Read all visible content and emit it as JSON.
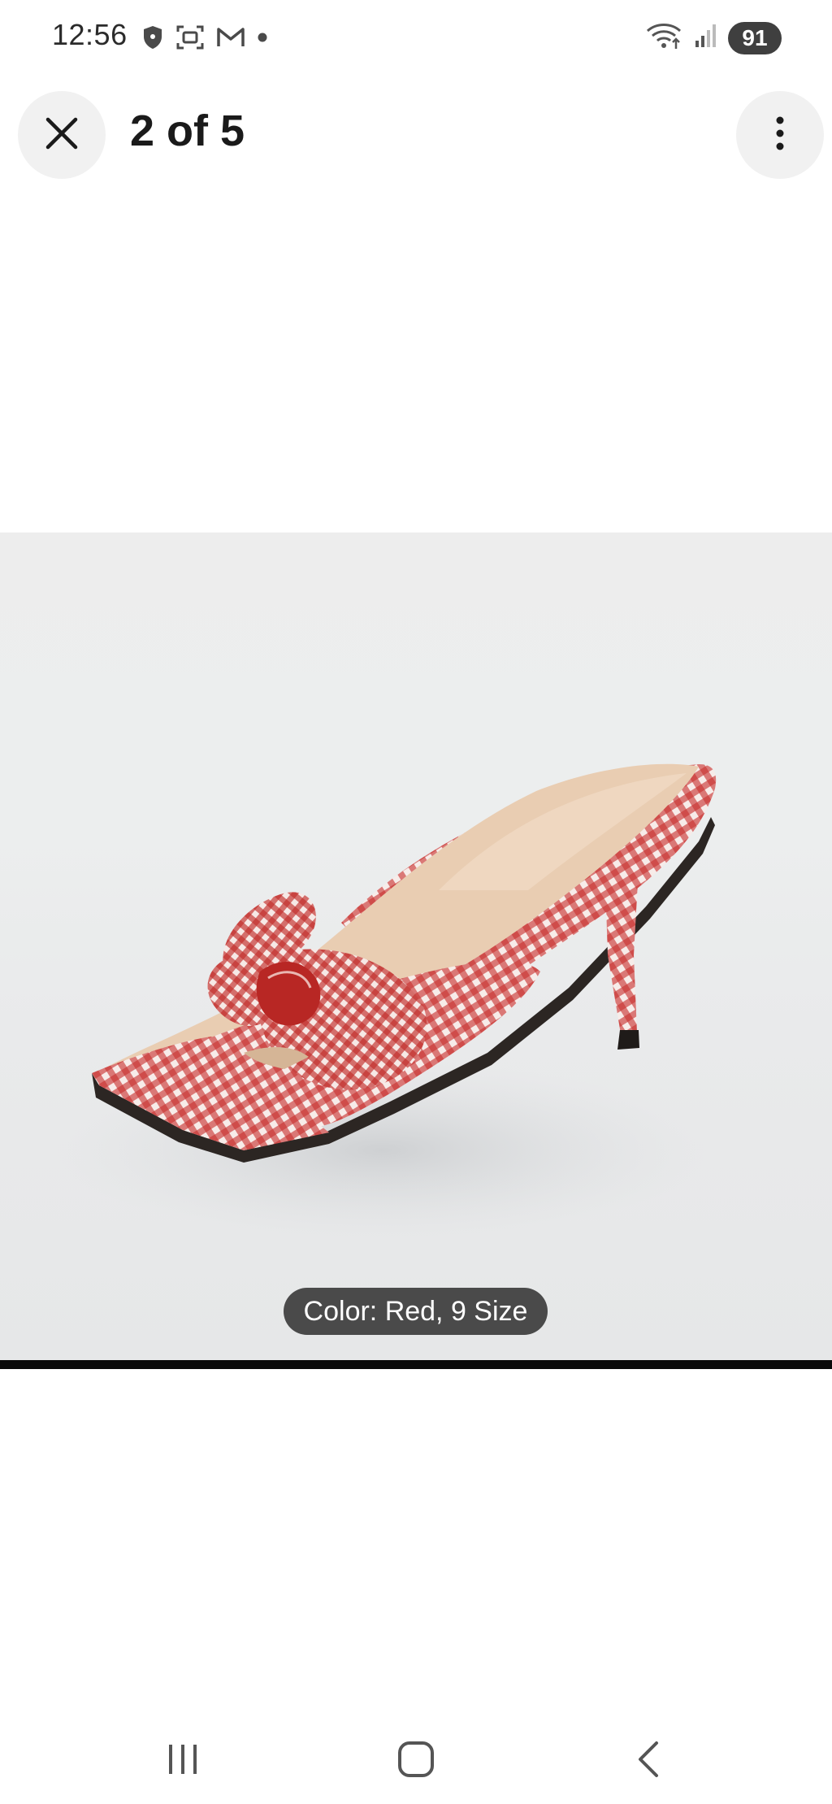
{
  "status_bar": {
    "time": "12:56",
    "battery": "91",
    "left_icons": [
      "shield-icon",
      "screenshot-icon",
      "gmail-icon",
      "notification-dot-icon"
    ],
    "right_icons": [
      "wifi-icon",
      "signal-icon",
      "battery-icon"
    ]
  },
  "header": {
    "counter": "2 of 5",
    "close_icon": "close-icon",
    "more_icon": "more-vertical-icon"
  },
  "photo": {
    "subject": "red and white gingham bow heeled mule sandal",
    "caption": "Color: Red, 9 Size"
  },
  "nav_bar": {
    "recents_icon": "recents-icon",
    "home_icon": "home-icon",
    "back_icon": "back-icon"
  },
  "colors": {
    "gingham_red": "#c8312e",
    "insole_tan": "#e7c9ad",
    "caption_bg": "#4a4a4a",
    "battery_bg": "#3f3f3f"
  }
}
